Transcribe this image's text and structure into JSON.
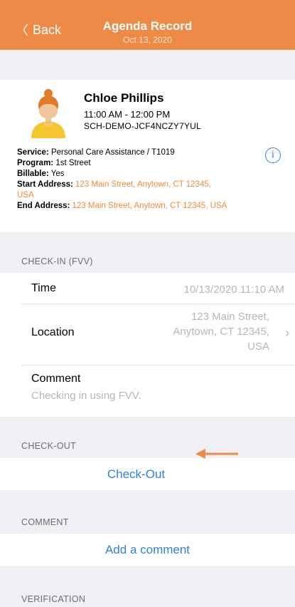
{
  "nav": {
    "back_label": "Back",
    "title": "Agenda Record",
    "subtitle": "Oct 13, 2020"
  },
  "client": {
    "name": "Chloe Phillips",
    "time": "11:00 AM - 12:00 PM",
    "id": "SCH-DEMO-JCF4NCZY7YUL"
  },
  "details": {
    "service_label": "Service:",
    "service": "Personal Care Assistance / T1019",
    "program_label": "Program:",
    "program": "1st Street",
    "billable_label": "Billable:",
    "billable": "Yes",
    "start_label": "Start Address:",
    "start_address": "123 Main Street, Anytown, CT 12345, USA",
    "end_label": "End Address:",
    "end_address": "123 Main Street, Anytown, CT 12345, USA"
  },
  "checkin": {
    "header": "CHECK-IN (FVV)",
    "time_label": "Time",
    "time_value": "10/13/2020 11:10 AM",
    "location_label": "Location",
    "location_line1": "123 Main Street,",
    "location_line2": "Anytown, CT 12345,",
    "location_line3": "USA",
    "comment_label": "Comment",
    "comment_value": "Checking in using FVV."
  },
  "checkout": {
    "header": "CHECK-OUT",
    "action": "Check-Out"
  },
  "comment": {
    "header": "COMMENT",
    "action": "Add a comment"
  },
  "verification": {
    "header": "VERIFICATION"
  },
  "colors": {
    "accent": "#ee8a48",
    "link": "#2f7fe0",
    "address": "#ef8a3c"
  },
  "icons": {
    "back": "chevron-left-icon",
    "info": "info-icon",
    "disclosure": "chevron-right-icon",
    "annotation": "arrow-left-icon"
  }
}
